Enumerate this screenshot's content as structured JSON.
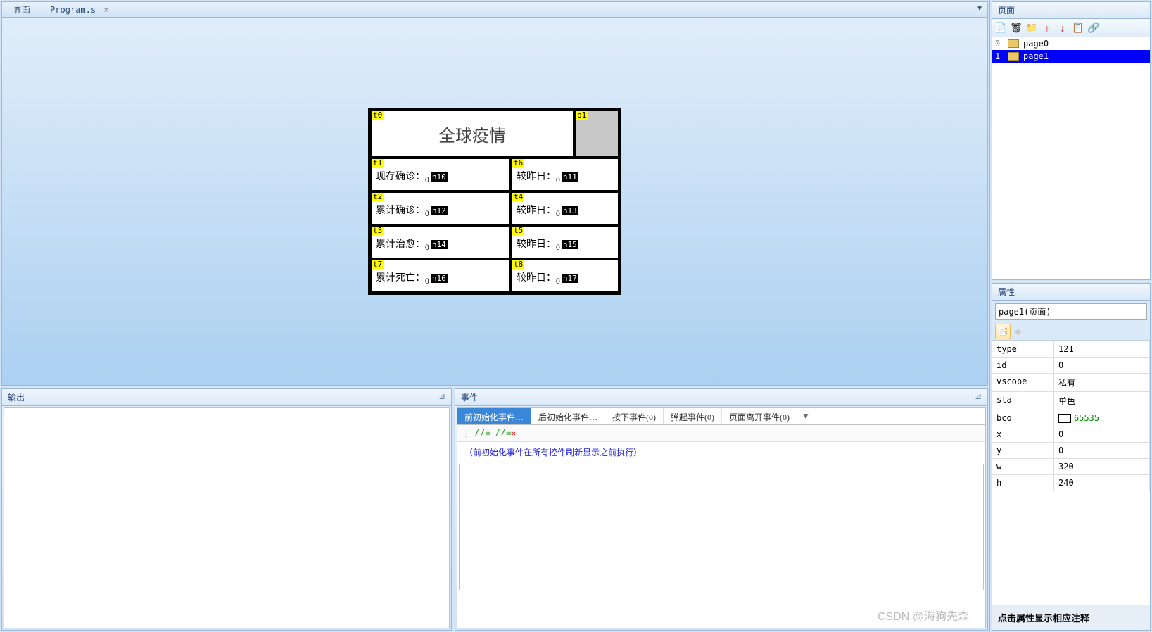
{
  "canvas": {
    "tab1": "界面",
    "tab2": "Program.s",
    "close": "×",
    "dropdown": "▼"
  },
  "hmi": {
    "t0": "t0",
    "b1": "b1",
    "title": "全球疫情",
    "rows": [
      {
        "ltag": "t1",
        "llabel": "现存确诊：",
        "lntag": "n10",
        "rtag": "t6",
        "rlabel": "较昨日：",
        "rntag": "n11"
      },
      {
        "ltag": "t2",
        "llabel": "累计确诊：",
        "lntag": "n12",
        "rtag": "t4",
        "rlabel": "较昨日：",
        "rntag": "n13"
      },
      {
        "ltag": "t3",
        "llabel": "累计治愈：",
        "lntag": "n14",
        "rtag": "t5",
        "rlabel": "较昨日：",
        "rntag": "n15"
      },
      {
        "ltag": "t7",
        "llabel": "累计死亡：",
        "lntag": "n16",
        "rtag": "t8",
        "rlabel": "较昨日：",
        "rntag": "n17"
      }
    ]
  },
  "output": {
    "title": "输出",
    "pin": "📌"
  },
  "events": {
    "title": "事件",
    "tabs": [
      "前初始化事件…",
      "后初始化事件…",
      "按下事件(0)",
      "弹起事件(0)",
      "页面离开事件(0)"
    ],
    "dropdown": "▼",
    "note": "（前初始化事件在所有控件刷新显示之前执行）"
  },
  "pages": {
    "title": "页面",
    "items": [
      {
        "idx": "0",
        "name": "page0"
      },
      {
        "idx": "1",
        "name": "page1"
      }
    ]
  },
  "props": {
    "title": "属性",
    "selector": "page1(页面)",
    "rows": [
      {
        "k": "type",
        "v": "121"
      },
      {
        "k": "id",
        "v": "0"
      },
      {
        "k": "vscope",
        "v": "私有"
      },
      {
        "k": "sta",
        "v": "单色"
      },
      {
        "k": "bco",
        "v": "65535",
        "swatch": true,
        "green": true
      },
      {
        "k": "x",
        "v": "0"
      },
      {
        "k": "y",
        "v": "0"
      },
      {
        "k": "w",
        "v": "320"
      },
      {
        "k": "h",
        "v": "240"
      }
    ],
    "hint": "点击属性显示相应注释"
  },
  "watermark": "CSDN @海狗先森"
}
